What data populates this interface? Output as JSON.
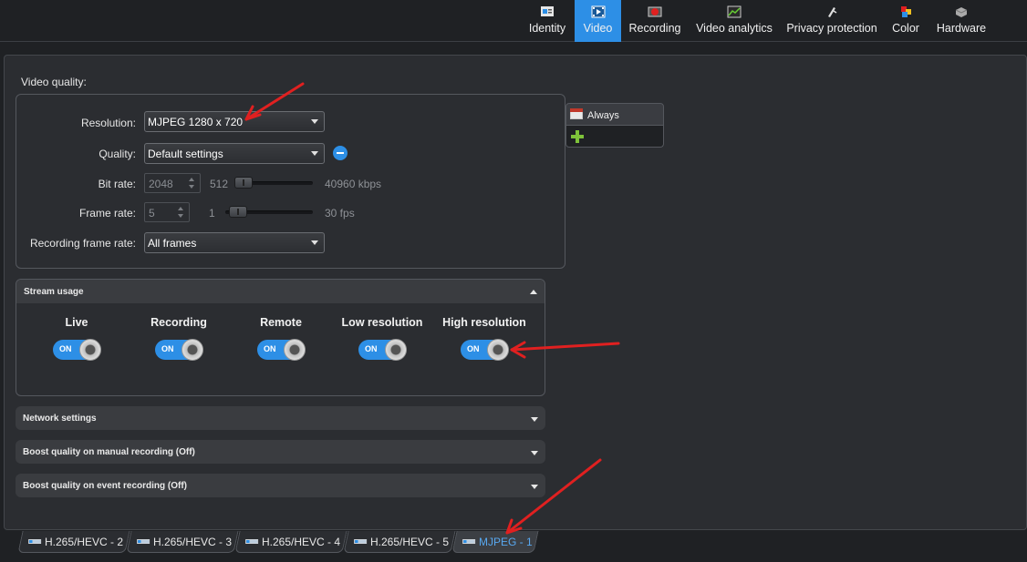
{
  "top_tabs": [
    {
      "label": "Identity",
      "icon": "identity-icon"
    },
    {
      "label": "Video",
      "icon": "video-icon",
      "active": true
    },
    {
      "label": "Recording",
      "icon": "recording-icon"
    },
    {
      "label": "Video analytics",
      "icon": "video-analytics-icon"
    },
    {
      "label": "Privacy protection",
      "icon": "privacy-protection-icon"
    },
    {
      "label": "Color",
      "icon": "color-icon"
    },
    {
      "label": "Hardware",
      "icon": "hardware-icon"
    }
  ],
  "video_quality": {
    "title": "Video quality:",
    "resolution": {
      "label": "Resolution:",
      "value": "MJPEG 1280 x 720"
    },
    "quality": {
      "label": "Quality:",
      "value": "Default settings"
    },
    "bit_rate": {
      "label": "Bit rate:",
      "value": "2048",
      "min": "512",
      "max": "40960 kbps"
    },
    "frame_rate": {
      "label": "Frame rate:",
      "value": "5",
      "min": "1",
      "max": "30 fps"
    },
    "recording_frame_rate": {
      "label": "Recording frame rate:",
      "value": "All frames"
    }
  },
  "schedule": {
    "label": "Always"
  },
  "stream_usage": {
    "title": "Stream usage",
    "toggles": [
      {
        "label": "Live",
        "state": "ON"
      },
      {
        "label": "Recording",
        "state": "ON"
      },
      {
        "label": "Remote",
        "state": "ON"
      },
      {
        "label": "Low resolution",
        "state": "ON"
      },
      {
        "label": "High resolution",
        "state": "ON"
      }
    ]
  },
  "sections": {
    "network": "Network settings",
    "boost_manual": "Boost quality on manual recording (Off)",
    "boost_event": "Boost quality on event recording (Off)"
  },
  "stream_tabs": [
    {
      "label": "H.265/HEVC - 2"
    },
    {
      "label": "H.265/HEVC - 3"
    },
    {
      "label": "H.265/HEVC - 4"
    },
    {
      "label": "H.265/HEVC - 5"
    },
    {
      "label": "MJPEG - 1",
      "active": true
    }
  ],
  "colors": {
    "accent": "#2d8fe6",
    "annotation": "#e02020",
    "background": "#1f2124",
    "panel": "#2b2d31"
  }
}
